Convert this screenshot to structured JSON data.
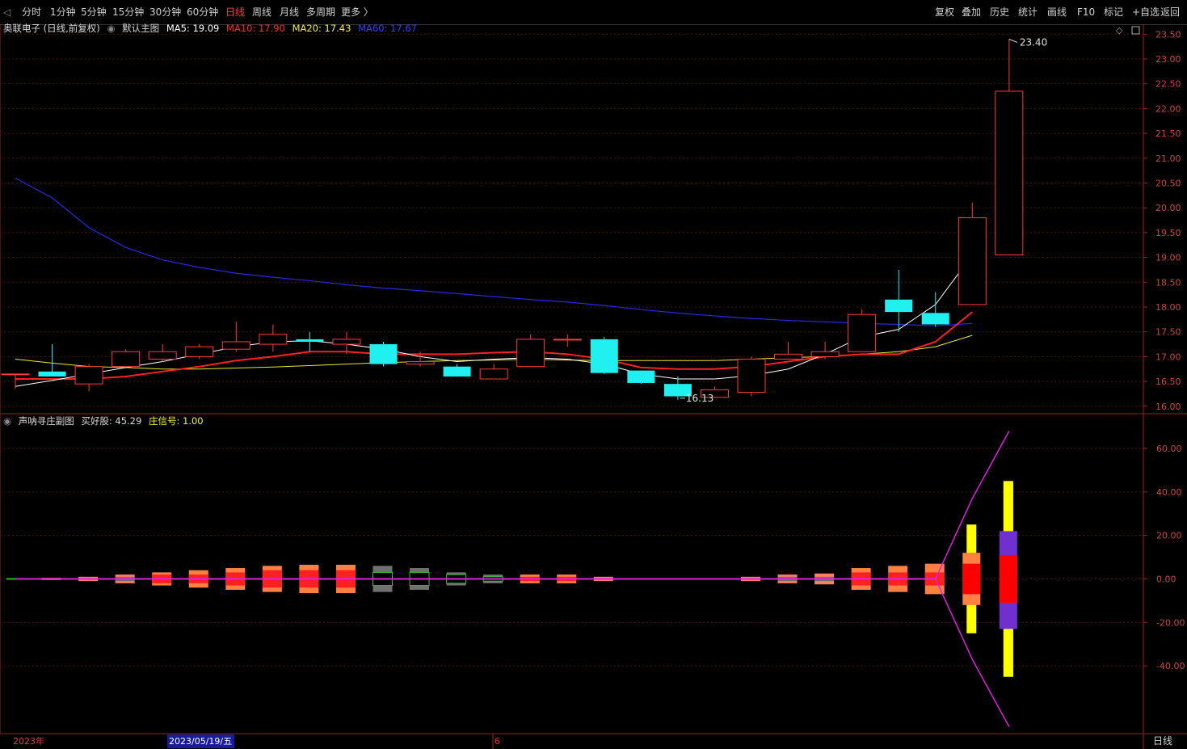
{
  "toolbar": {
    "left": [
      {
        "label": "分时",
        "active": false
      },
      {
        "label": "1分钟",
        "active": false
      },
      {
        "label": "5分钟",
        "active": false
      },
      {
        "label": "15分钟",
        "active": false
      },
      {
        "label": "30分钟",
        "active": false
      },
      {
        "label": "60分钟",
        "active": false
      },
      {
        "label": "日线",
        "active": true
      },
      {
        "label": "周线",
        "active": false
      },
      {
        "label": "月线",
        "active": false
      },
      {
        "label": "多周期",
        "active": false
      },
      {
        "label": "更多 〉",
        "active": false
      }
    ],
    "right": [
      "复权",
      "叠加",
      "历史",
      "统计",
      "画线",
      "F10",
      "标记",
      "+自选",
      "返回"
    ]
  },
  "main_chart": {
    "title": "奥联电子 (日线,前复权)",
    "template": "默认主图",
    "ma": [
      {
        "label": "MA5: 19.09",
        "color": "#ffffff"
      },
      {
        "label": "MA10: 17.90",
        "color": "#ff2a2a"
      },
      {
        "label": "MA20: 17.43",
        "color": "#f0f030"
      },
      {
        "label": "MA60: 17.67",
        "color": "#3a3aff"
      }
    ],
    "y_ticks": [
      "23.50",
      "23.00",
      "22.50",
      "22.00",
      "21.50",
      "21.00",
      "20.50",
      "20.00",
      "19.50",
      "19.00",
      "18.50",
      "18.00",
      "17.50",
      "17.00",
      "16.50",
      "16.00"
    ],
    "y_range": [
      15.85,
      23.7
    ],
    "high_label": "23.40",
    "low_label": "16.13"
  },
  "sub_chart": {
    "title": "声呐寻庄副图",
    "indicator1": {
      "label": "买好股: 45.29",
      "color": "#d0d0d0"
    },
    "indicator2": {
      "label": "庄信号: 1.00",
      "color": "#f0f030"
    },
    "y_ticks": [
      "60.00",
      "40.00",
      "20.00",
      "0.00",
      "-20.00",
      "-40.00"
    ],
    "y_range": [
      -68,
      68
    ]
  },
  "bottom_bar": {
    "year_label": "2023年",
    "date_label": "2023/05/19/五",
    "month_label": "6",
    "period_label": "日线"
  },
  "chart_data": {
    "type": "candlestick",
    "candles": [
      {
        "o": 16.65,
        "h": 16.65,
        "l": 16.35,
        "c": 16.65
      },
      {
        "o": 16.7,
        "h": 17.25,
        "l": 16.6,
        "c": 16.6
      },
      {
        "o": 16.45,
        "h": 16.85,
        "l": 16.3,
        "c": 16.8
      },
      {
        "o": 16.8,
        "h": 17.15,
        "l": 16.8,
        "c": 17.1
      },
      {
        "o": 16.95,
        "h": 17.25,
        "l": 16.9,
        "c": 17.1
      },
      {
        "o": 17.0,
        "h": 17.25,
        "l": 16.95,
        "c": 17.2
      },
      {
        "o": 17.15,
        "h": 17.7,
        "l": 17.1,
        "c": 17.3
      },
      {
        "o": 17.25,
        "h": 17.65,
        "l": 17.1,
        "c": 17.45
      },
      {
        "o": 17.35,
        "h": 17.5,
        "l": 17.1,
        "c": 17.3
      },
      {
        "o": 17.25,
        "h": 17.5,
        "l": 17.05,
        "c": 17.35
      },
      {
        "o": 17.25,
        "h": 17.3,
        "l": 16.8,
        "c": 16.85
      },
      {
        "o": 16.85,
        "h": 17.1,
        "l": 16.8,
        "c": 16.9
      },
      {
        "o": 16.8,
        "h": 16.85,
        "l": 16.6,
        "c": 16.6
      },
      {
        "o": 16.55,
        "h": 16.85,
        "l": 16.55,
        "c": 16.75
      },
      {
        "o": 16.8,
        "h": 17.45,
        "l": 16.8,
        "c": 17.35
      },
      {
        "o": 17.35,
        "h": 17.45,
        "l": 17.2,
        "c": 17.35
      },
      {
        "o": 17.35,
        "h": 17.4,
        "l": 16.65,
        "c": 16.67
      },
      {
        "o": 16.72,
        "h": 16.72,
        "l": 16.45,
        "c": 16.47
      },
      {
        "o": 16.45,
        "h": 16.6,
        "l": 16.13,
        "c": 16.2
      },
      {
        "o": 16.18,
        "h": 16.4,
        "l": 16.18,
        "c": 16.33
      },
      {
        "o": 16.28,
        "h": 17.0,
        "l": 16.2,
        "c": 16.95
      },
      {
        "o": 16.95,
        "h": 17.3,
        "l": 16.95,
        "c": 17.05
      },
      {
        "o": 17.0,
        "h": 17.3,
        "l": 16.95,
        "c": 17.1
      },
      {
        "o": 17.1,
        "h": 17.95,
        "l": 17.1,
        "c": 17.85
      },
      {
        "o": 18.15,
        "h": 18.75,
        "l": 17.5,
        "c": 17.9
      },
      {
        "o": 17.88,
        "h": 18.3,
        "l": 17.6,
        "c": 17.65
      },
      {
        "o": 18.05,
        "h": 20.1,
        "l": 18.05,
        "c": 19.8
      },
      {
        "o": 19.05,
        "h": 23.4,
        "l": 19.05,
        "c": 22.35
      }
    ],
    "ma5": [
      16.4,
      16.52,
      16.65,
      16.78,
      16.9,
      17.05,
      17.2,
      17.3,
      17.32,
      17.25,
      17.15,
      17.0,
      16.9,
      16.95,
      16.98,
      16.95,
      16.85,
      16.65,
      16.55,
      16.55,
      16.62,
      16.75,
      17.05,
      17.4,
      17.55,
      18.05,
      19.05
    ],
    "ma10": [
      16.55,
      16.55,
      16.55,
      16.6,
      16.7,
      16.8,
      16.92,
      17.0,
      17.1,
      17.1,
      17.05,
      17.05,
      17.05,
      17.08,
      17.1,
      17.05,
      16.95,
      16.78,
      16.75,
      16.75,
      16.8,
      16.9,
      17.0,
      17.05,
      17.05,
      17.3,
      17.9
    ],
    "ma20": [
      16.95,
      16.87,
      16.8,
      16.78,
      16.75,
      16.75,
      16.77,
      16.79,
      16.82,
      16.85,
      16.88,
      16.9,
      16.92,
      16.93,
      16.95,
      16.93,
      16.92,
      16.92,
      16.92,
      16.92,
      16.95,
      16.98,
      17.0,
      17.05,
      17.1,
      17.2,
      17.43
    ],
    "ma60": [
      20.6,
      20.2,
      19.6,
      19.2,
      18.95,
      18.8,
      18.68,
      18.6,
      18.53,
      18.45,
      18.38,
      18.33,
      18.27,
      18.21,
      18.15,
      18.1,
      18.03,
      17.95,
      17.88,
      17.82,
      17.77,
      17.73,
      17.7,
      17.67,
      17.65,
      17.62,
      17.67
    ],
    "sub_bars": [
      {
        "outer": 0.5,
        "inner": 0,
        "color": "flat"
      },
      {
        "outer": 1,
        "inner": 0,
        "color": "flat"
      },
      {
        "outer": 2,
        "inner": 1,
        "color": "flat"
      },
      {
        "outer": 3,
        "inner": 2,
        "color": "red"
      },
      {
        "outer": 4,
        "inner": 2,
        "color": "red"
      },
      {
        "outer": 5,
        "inner": 3,
        "color": "red"
      },
      {
        "outer": 6,
        "inner": 4,
        "color": "red"
      },
      {
        "outer": 6.5,
        "inner": 4,
        "color": "red"
      },
      {
        "outer": 6.5,
        "inner": 4,
        "color": "red"
      },
      {
        "outer": 6,
        "inner": 3,
        "color": "gray"
      },
      {
        "outer": 5,
        "inner": 3,
        "color": "gray"
      },
      {
        "outer": 3,
        "inner": 2,
        "color": "gray"
      },
      {
        "outer": 2,
        "inner": 1,
        "color": "gray"
      },
      {
        "outer": 2,
        "inner": 1,
        "color": "red"
      },
      {
        "outer": 2,
        "inner": 1,
        "color": "red"
      },
      {
        "outer": 1,
        "inner": 0,
        "color": "flat"
      },
      {
        "outer": 0,
        "inner": 0,
        "color": "none"
      },
      {
        "outer": 0,
        "inner": 0,
        "color": "none"
      },
      {
        "outer": 0,
        "inner": 0,
        "color": "none"
      },
      {
        "outer": 1,
        "inner": 0,
        "color": "flat"
      },
      {
        "outer": 2,
        "inner": 1,
        "color": "flat"
      },
      {
        "outer": 2.5,
        "inner": 1,
        "color": "flat"
      },
      {
        "outer": 5,
        "inner": 3,
        "color": "red"
      },
      {
        "outer": 6,
        "inner": 3,
        "color": "red"
      },
      {
        "outer": 7,
        "inner": 3,
        "color": "red"
      },
      {
        "outer": 12,
        "inner": 7,
        "color": "big"
      },
      {
        "outer": 22,
        "inner": 12,
        "color": "big2"
      }
    ],
    "big_yellow": [
      0,
      0,
      0,
      0,
      0,
      0,
      0,
      0,
      0,
      0,
      0,
      0,
      0,
      0,
      0,
      0,
      0,
      0,
      0,
      0,
      0,
      0,
      0,
      0,
      0,
      25,
      45
    ],
    "envelope": [
      0,
      0,
      0,
      0,
      0,
      0,
      0,
      0,
      0,
      0,
      0,
      0,
      0,
      0,
      0,
      0,
      0,
      0,
      0,
      0,
      0,
      0,
      0,
      0,
      0,
      0,
      37,
      68
    ]
  }
}
